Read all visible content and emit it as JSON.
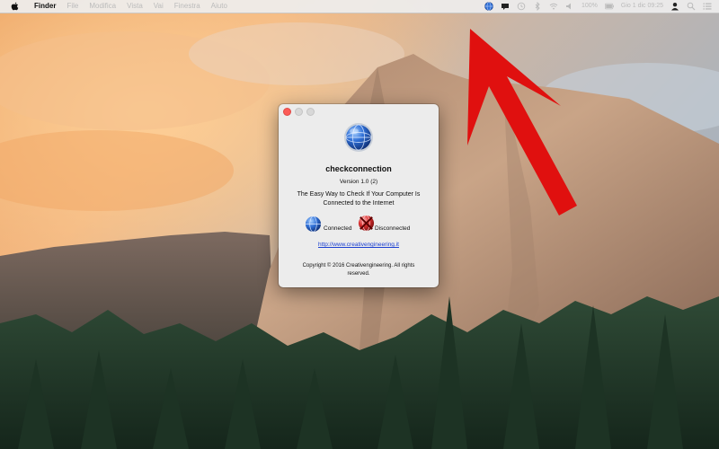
{
  "menubar": {
    "app_name": "Finder",
    "menus": [
      "File",
      "Modifica",
      "Vista",
      "Vai",
      "Finestra",
      "Aiuto"
    ],
    "battery": "100%",
    "clock": "Gio 1 dic  09:25"
  },
  "window": {
    "app_name": "checkconnection",
    "version": "Version 1.0 (2)",
    "tagline": "The Easy Way to Check If Your Computer Is Connected to the Internet",
    "connected_label": "Connected",
    "disconnected_label": "Disconnected",
    "link": "http://www.creativengineering.it",
    "copyright": "Copyright © 2016 Creativengineering. All rights reserved."
  },
  "colors": {
    "arrow": "#e0100f",
    "link": "#1a3fd1",
    "close_button": "#fc5b57"
  },
  "icons": {
    "apple": "apple-logo-icon",
    "status_globe": "globe-icon",
    "app": "globe-icon",
    "disconnected": "globe-x-icon"
  }
}
